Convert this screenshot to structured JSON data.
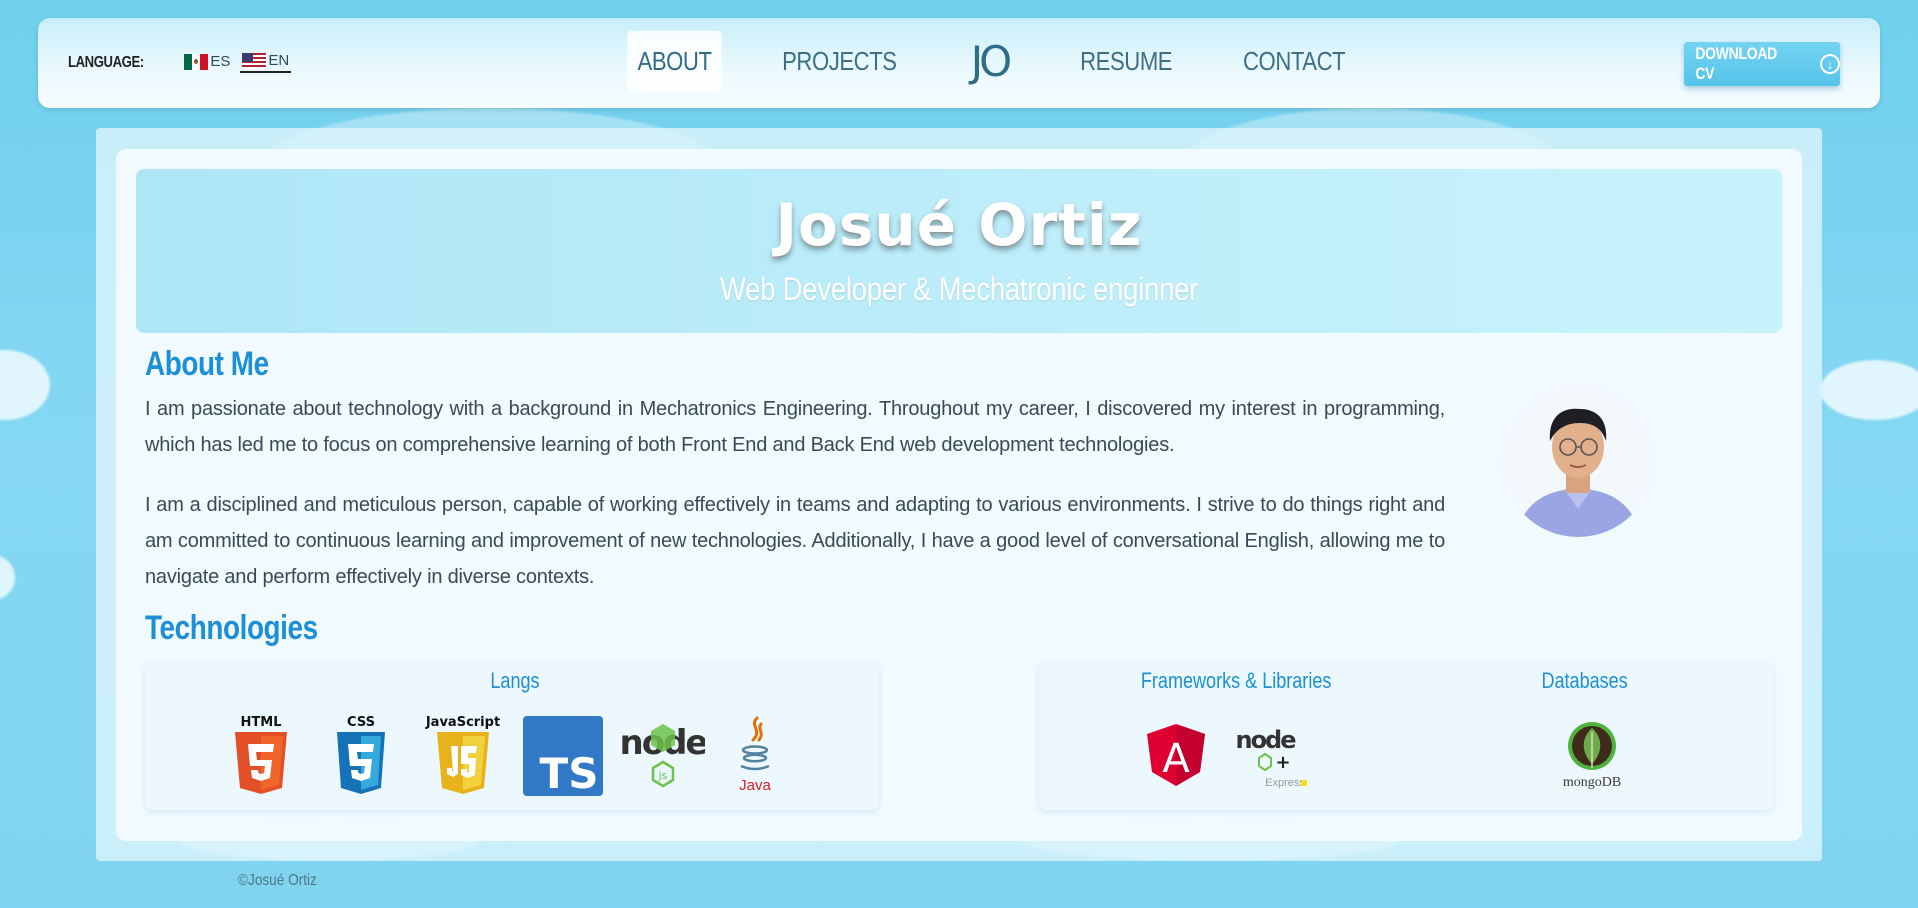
{
  "header": {
    "language_label": "LANGUAGE:",
    "languages": [
      {
        "code": "ES",
        "active": false
      },
      {
        "code": "EN",
        "active": true
      }
    ],
    "nav": [
      {
        "label": "ABOUT",
        "active": true
      },
      {
        "label": "PROJECTS",
        "active": false
      },
      {
        "label": "RESUME",
        "active": false
      },
      {
        "label": "CONTACT",
        "active": false
      }
    ],
    "logo": "JO",
    "download_label": "DOWNLOAD CV"
  },
  "hero": {
    "name": "Josué Ortiz",
    "subtitle": "Web Developer & Mechatronic enginner"
  },
  "about": {
    "title": "About Me",
    "paragraphs": [
      "I am passionate about technology with a background in Mechatronics Engineering. Throughout my career, I discovered my interest in programming, which has led me to focus on comprehensive learning of both Front End and Back End web development technologies.",
      "I am a disciplined and meticulous person, capable of working effectively in teams and adapting to various environments. I strive to do things right and am committed to continuous learning and improvement of new technologies. Additionally, I have a good level of conversational English, allowing me to navigate and perform effectively in diverse contexts."
    ]
  },
  "technologies": {
    "title": "Technologies",
    "langs_title": "Langs",
    "langs": [
      "HTML",
      "CSS",
      "JavaScript",
      "TS",
      "node",
      "Java"
    ],
    "frameworks_title": "Frameworks & Libraries",
    "frameworks": [
      "A",
      "node",
      "Express"
    ],
    "databases_title": "Databases",
    "databases": [
      "mongoDB"
    ]
  },
  "footer": {
    "copyright": "©Josué Ortiz"
  },
  "colors": {
    "accent": "#1d8fd6",
    "nav_text": "#3d6f86",
    "button": "#55c4ea"
  }
}
